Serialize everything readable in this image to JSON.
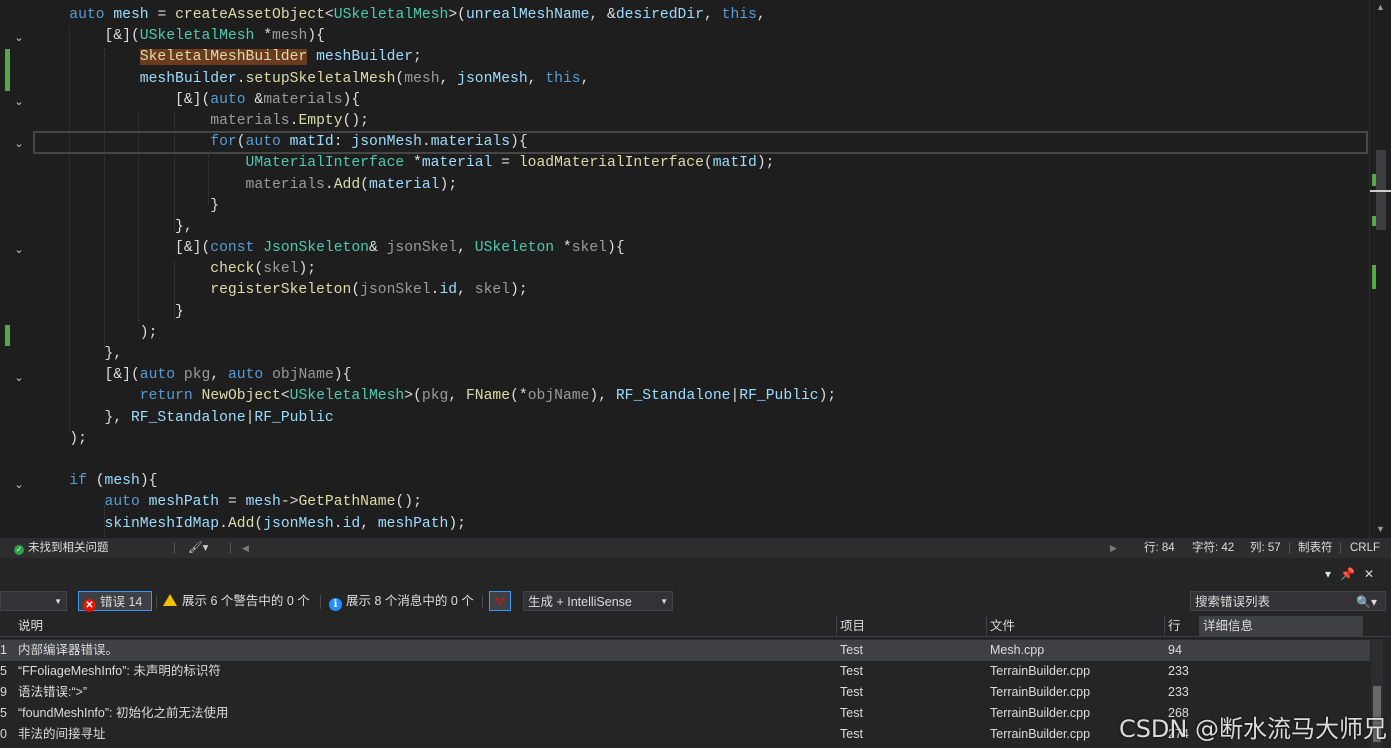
{
  "editor": {
    "lines": [
      {
        "html": "    <span class=\"kw\">auto</span> <span class=\"var\">mesh</span> = <span class=\"fn\">createAssetObject</span>&lt;<span class=\"ty\">USkeletalMesh</span>&gt;(<span class=\"var\">unrealMeshName</span>, &amp;<span class=\"var\">desiredDir</span>, <span class=\"kw\">this</span>,"
      },
      {
        "html": "        [&amp;](<span class=\"ty\">USkeletalMesh</span> *<span class=\"pa\">mesh</span>){"
      },
      {
        "html": "            <span class=\"hl\">SkeletalMeshBuilder</span> <span class=\"var\">meshBuilder</span>;"
      },
      {
        "html": "            <span class=\"var\">meshBuilder</span>.<span class=\"fn\">setupSkeletalMesh</span>(<span class=\"pa\">mesh</span>, <span class=\"var\">jsonMesh</span>, <span class=\"kw\">this</span>,"
      },
      {
        "html": "                [&amp;](<span class=\"kw\">auto</span> &amp;<span class=\"pa\">materials</span>){"
      },
      {
        "html": "                    <span class=\"pa\">materials</span>.<span class=\"fn\">Empty</span>();"
      },
      {
        "html": "                    <span class=\"kw\">for</span>(<span class=\"kw\">auto</span> <span class=\"var\">matId</span>: <span class=\"var\">jsonMesh</span>.<span class=\"var\">materials</span>){"
      },
      {
        "html": "                        <span class=\"ty\">UMaterialInterface</span> *<span class=\"var\">material</span> = <span class=\"fn\">loadMaterialInterface</span>(<span class=\"var\">matId</span>);"
      },
      {
        "html": "                        <span class=\"pa\">materials</span>.<span class=\"fn\">Add</span>(<span class=\"var\">material</span>);"
      },
      {
        "html": "                    }"
      },
      {
        "html": "                },"
      },
      {
        "html": "                [&amp;](<span class=\"kw\">const</span> <span class=\"ty\">JsonSkeleton</span>&amp; <span class=\"pa\">jsonSkel</span>, <span class=\"ty\">USkeleton</span> *<span class=\"pa\">skel</span>){"
      },
      {
        "html": "                    <span class=\"fn\">check</span>(<span class=\"pa\">skel</span>);"
      },
      {
        "html": "                    <span class=\"fn\">registerSkeleton</span>(<span class=\"pa\">jsonSkel</span>.<span class=\"var\">id</span>, <span class=\"pa\">skel</span>);"
      },
      {
        "html": "                }"
      },
      {
        "html": "            );"
      },
      {
        "html": "        },"
      },
      {
        "html": "        [&amp;](<span class=\"kw\">auto</span> <span class=\"pa\">pkg</span>, <span class=\"kw\">auto</span> <span class=\"pa\">objName</span>){"
      },
      {
        "html": "            <span class=\"kw\">return</span> <span class=\"fn\">NewObject</span>&lt;<span class=\"ty\">USkeletalMesh</span>&gt;(<span class=\"pa\">pkg</span>, <span class=\"fn\">FName</span>(*<span class=\"pa\">objName</span>), <span class=\"var\">RF_Standalone</span>|<span class=\"var\">RF_Public</span>);"
      },
      {
        "html": "        }, <span class=\"var\">RF_Standalone</span>|<span class=\"var\">RF_Public</span>"
      },
      {
        "html": "    );"
      },
      {
        "html": ""
      },
      {
        "html": "    <span class=\"kw\">if</span> (<span class=\"var\">mesh</span>){"
      },
      {
        "html": "        <span class=\"kw\">auto</span> <span class=\"var\">meshPath</span> = <span class=\"var\">mesh</span>-&gt;<span class=\"fn\">GetPathName</span>();"
      },
      {
        "html": "        <span class=\"var\">skinMeshIdMap</span>.<span class=\"fn\">Add</span>(<span class=\"var\">jsonMesh</span>.<span class=\"var\">id</span>, <span class=\"var\">meshPath</span>);"
      }
    ]
  },
  "status_bar": {
    "health": "未找到相关问题",
    "line": "行: 84",
    "char": "字符: 42",
    "col": "列: 57",
    "tabs": "制表符",
    "eol": "CRLF"
  },
  "error_list": {
    "scope": "",
    "errors_label": "错误 14",
    "warnings_label": "展示 6 个警告中的 0 个",
    "messages_label": "展示 8 个消息中的 0 个",
    "source": "生成 + IntelliSense",
    "search_placeholder": "搜索错误列表",
    "headers": {
      "description": "说明",
      "project": "项目",
      "file": "文件",
      "line": "行",
      "details": "详细信息"
    },
    "rows": [
      {
        "code": "1",
        "description": "内部编译器错误。",
        "project": "Test",
        "file": "Mesh.cpp",
        "line": "94"
      },
      {
        "code": "5",
        "description": "“FFoliageMeshInfo”: 未声明的标识符",
        "project": "Test",
        "file": "TerrainBuilder.cpp",
        "line": "233"
      },
      {
        "code": "9",
        "description": "语法错误:“>”",
        "project": "Test",
        "file": "TerrainBuilder.cpp",
        "line": "233"
      },
      {
        "code": "5",
        "description": "“foundMeshInfo”: 初始化之前无法使用",
        "project": "Test",
        "file": "TerrainBuilder.cpp",
        "line": "268"
      },
      {
        "code": "0",
        "description": "非法的间接寻址",
        "project": "Test",
        "file": "TerrainBuilder.cpp",
        "line": "274"
      }
    ]
  },
  "watermark": "CSDN @断水流马大师兄"
}
